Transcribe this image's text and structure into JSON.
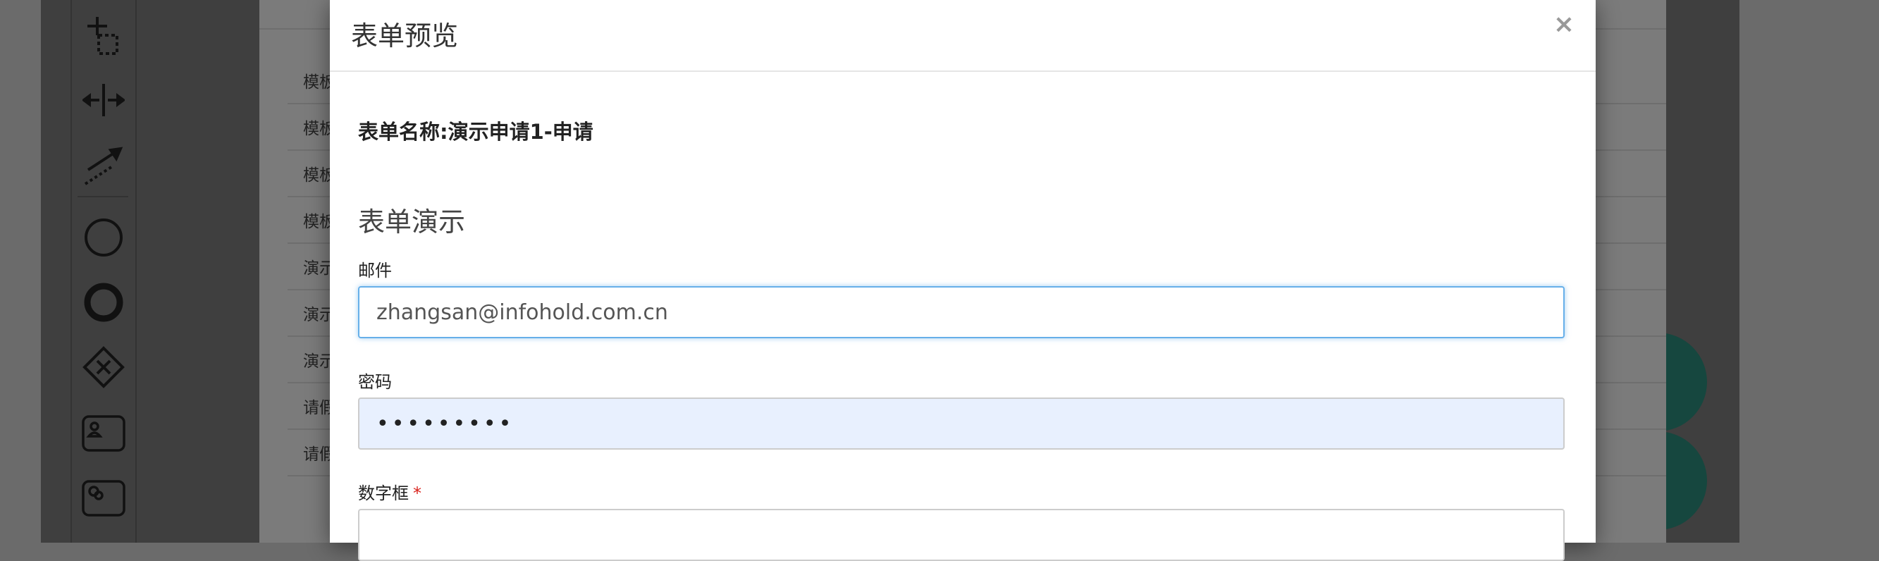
{
  "background": {
    "outer_list_rows": [
      {
        "label": "模板"
      },
      {
        "label": "模板"
      },
      {
        "label": "模板"
      },
      {
        "label": "模板"
      },
      {
        "label": "演示"
      },
      {
        "label": "演示"
      },
      {
        "label": "演示"
      },
      {
        "label": "请假"
      },
      {
        "label": "请假"
      }
    ],
    "palette_icons": [
      "lasso-tool-icon",
      "space-tool-icon",
      "connect-tool-icon",
      "start-event-icon",
      "end-event-icon",
      "gateway-icon",
      "user-task-icon",
      "service-task-icon"
    ],
    "fab_icons": [
      "cloud-upload-icon",
      "save-icon"
    ]
  },
  "modal": {
    "title": "表单预览",
    "close": "×",
    "form_name": "表单名称:演示申请1-申请",
    "section_title": "表单演示",
    "fields": {
      "email": {
        "label": "邮件",
        "value": "zhangsan@infohold.com.cn"
      },
      "password": {
        "label": "密码",
        "value": "•••••••••"
      },
      "number": {
        "label": "数字框",
        "required_mark": "*",
        "value": ""
      }
    }
  }
}
